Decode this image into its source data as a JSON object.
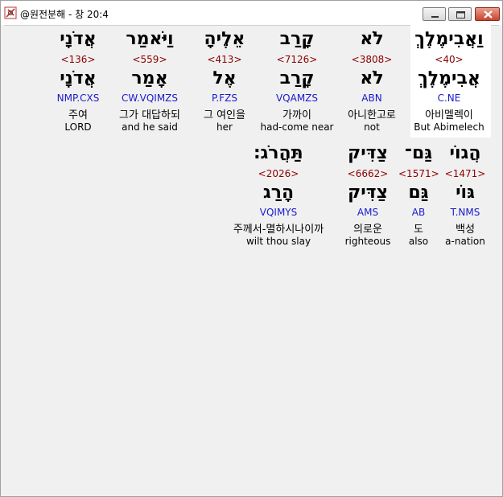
{
  "window": {
    "title": "@원전분해 - 창 20:4"
  },
  "row1": [
    {
      "heb1": "וַאֲבִימֶלֶךְ",
      "strong": "<40>",
      "heb2": "אֲבִימֶלֶךְ",
      "morph": "C.NE",
      "kor": "아비멜렉이",
      "eng": "But Abimelech"
    },
    {
      "heb1": "לֹא",
      "strong": "<3808>",
      "heb2": "לֹא",
      "morph": "ABN",
      "kor": "아니한고로",
      "eng": "not"
    },
    {
      "heb1": "קָרַב",
      "strong": "<7126>",
      "heb2": "קָרַב",
      "morph": "VQAMZS",
      "kor": "가까이",
      "eng": "had-come near"
    },
    {
      "heb1": "אֵלֶיהָ",
      "strong": "<413>",
      "heb2": "אֶל",
      "morph": "P.FZS",
      "kor": "그 여인을",
      "eng": "her"
    },
    {
      "heb1": "וַיֹּאמַר",
      "strong": "<559>",
      "heb2": "אָמַר",
      "morph": "CW.VQIMZS",
      "kor": "그가 대답하되",
      "eng": "and he said"
    },
    {
      "heb1": "אֲדֹנָי",
      "strong": "<136>",
      "heb2": "אֲדֹנָי",
      "morph": "NMP.CXS",
      "kor": "주여",
      "eng": "LORD"
    }
  ],
  "row2": [
    {
      "heb1": "הֲגוֹי",
      "strong": "<1471>",
      "heb2": "גּוֹי",
      "morph": "T.NMS",
      "kor": "백성",
      "eng": "a-nation"
    },
    {
      "heb1": "גַּם־",
      "strong": "<1571>",
      "heb2": "גַּם",
      "morph": "AB",
      "kor": "도",
      "eng": "also"
    },
    {
      "heb1": "צַדִּיק",
      "strong": "<6662>",
      "heb2": "צַדִּיק",
      "morph": "AMS",
      "kor": "의로운",
      "eng": "righteous"
    },
    {
      "heb1": "תַּהֲרֹג׃",
      "strong": "<2026>",
      "heb2": "הָרַג",
      "morph": "VQIMYS",
      "kor": "주께서-멸하시나이까",
      "eng": "wilt thou slay"
    }
  ]
}
